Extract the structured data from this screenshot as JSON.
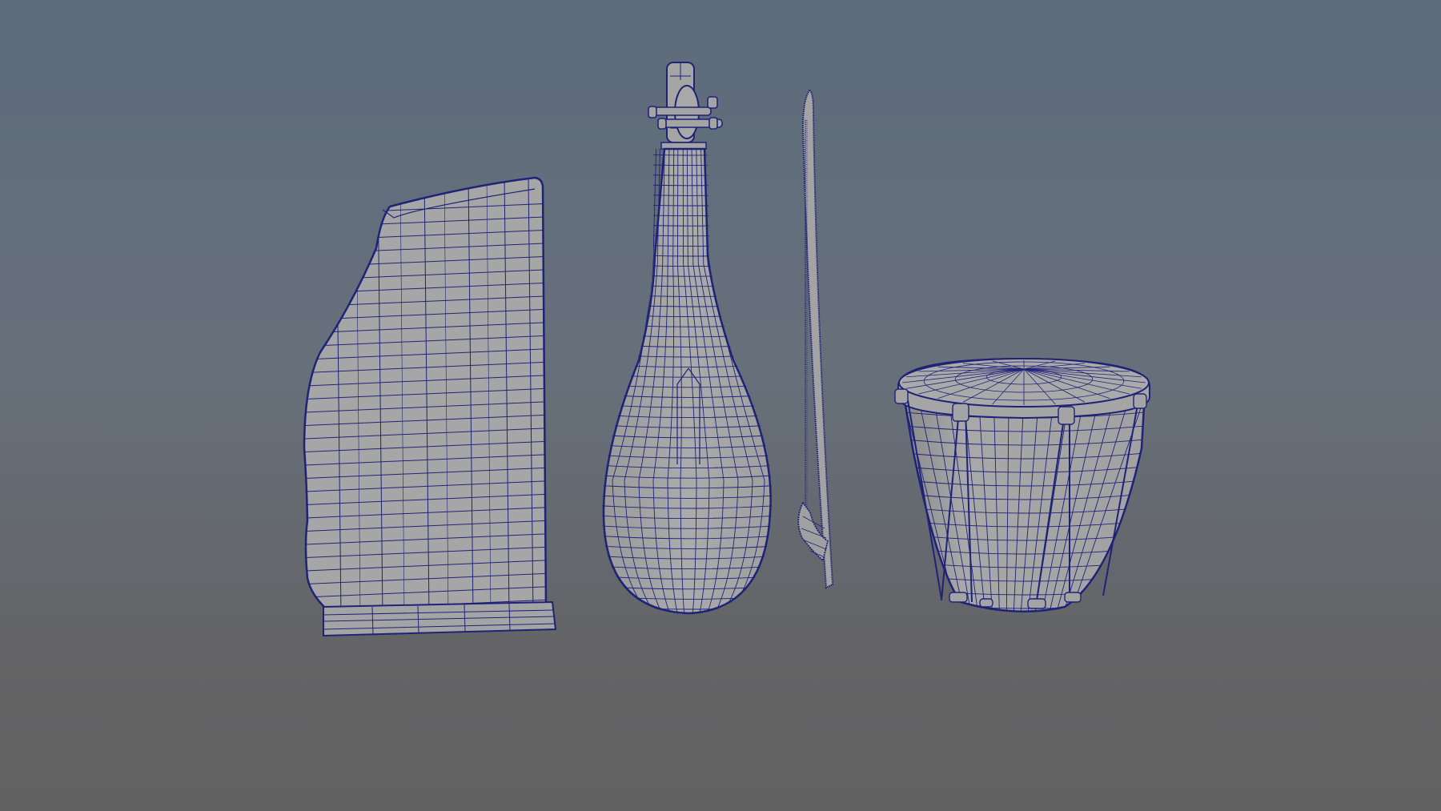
{
  "viewport": {
    "background_top": "#5d6b7b",
    "background_bottom": "#616161",
    "mesh_fill": "#a7a7a7",
    "mesh_shade": "#8e8e8e",
    "wire_color": "#1f2377",
    "wire_light": "#3a3d88"
  },
  "scene": {
    "models": [
      {
        "id": "harp",
        "icon": "wireframe-harp-mesh"
      },
      {
        "id": "lute",
        "icon": "wireframe-lute-mesh"
      },
      {
        "id": "bow",
        "icon": "wireframe-bow-mesh"
      },
      {
        "id": "drum",
        "icon": "wireframe-drum-mesh"
      }
    ]
  }
}
